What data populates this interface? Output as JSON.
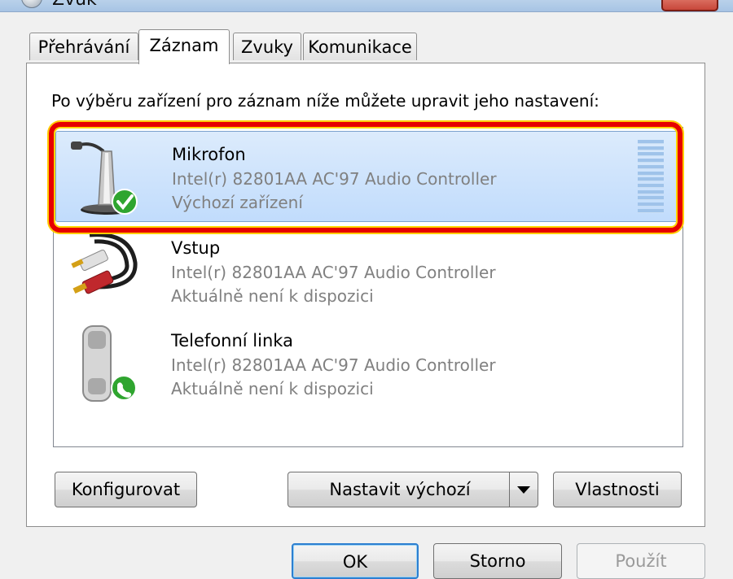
{
  "window": {
    "title": "Zvuk",
    "close_glyph": "✕"
  },
  "tabs": [
    {
      "label": "Přehrávání",
      "active": false
    },
    {
      "label": "Záznam",
      "active": true
    },
    {
      "label": "Zvuky",
      "active": false
    },
    {
      "label": "Komunikace",
      "active": false
    }
  ],
  "panel": {
    "instruction": "Po výběru zařízení pro záznam níže můžete upravit jeho nastavení:"
  },
  "devices": [
    {
      "name": "Mikrofon",
      "description": "Intel(r) 82801AA AC'97 Audio Controller",
      "status": "Výchozí zařízení",
      "icon": "microphone-icon",
      "badge": "default-check-icon",
      "selected": true
    },
    {
      "name": "Vstup",
      "description": "Intel(r) 82801AA AC'97 Audio Controller",
      "status": "Aktuálně není k dispozici",
      "icon": "rca-cable-icon",
      "selected": false
    },
    {
      "name": "Telefonní linka",
      "description": "Intel(r) 82801AA AC'97 Audio Controller",
      "status": "Aktuálně není k dispozici",
      "icon": "telephone-handset-icon",
      "badge": "phone-call-icon",
      "selected": false
    }
  ],
  "buttons": {
    "configure": "Konfigurovat",
    "set_default": "Nastavit výchozí",
    "properties": "Vlastnosti",
    "ok": "OK",
    "cancel": "Storno",
    "apply": "Použít"
  },
  "colors": {
    "highlight": "#e60000",
    "selection": "#c1dcfc",
    "check_badge": "#2fa52f"
  }
}
